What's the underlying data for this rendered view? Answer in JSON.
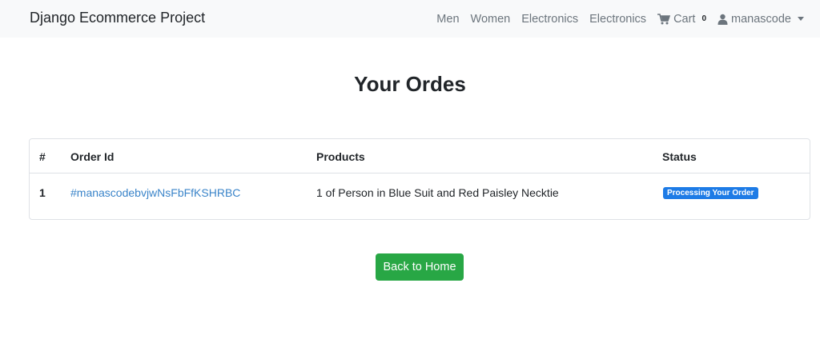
{
  "navbar": {
    "brand": "Django Ecommerce Project",
    "links": [
      {
        "label": "Men"
      },
      {
        "label": "Women"
      },
      {
        "label": "Electronics"
      },
      {
        "label": "Electronics"
      }
    ],
    "cart": {
      "label": "Cart",
      "count": "0",
      "icon": "cart-icon"
    },
    "user": {
      "label": "manascode",
      "icon": "user-icon"
    }
  },
  "main": {
    "title": "Your Ordes",
    "table": {
      "headers": [
        "#",
        "Order Id",
        "Products",
        "Status"
      ],
      "rows": [
        {
          "num": "1",
          "order_id": "#manascodebvjwNsFbFfKSHRBC",
          "product": "1 of Person in Blue Suit and Red Paisley Necktie",
          "status": "Processing Your Order"
        }
      ]
    },
    "back_button": "Back to Home"
  },
  "colors": {
    "navbar_bg": "#f8f9fa",
    "link": "#3a84c9",
    "badge": "#1d7be6",
    "button": "#28a745"
  }
}
